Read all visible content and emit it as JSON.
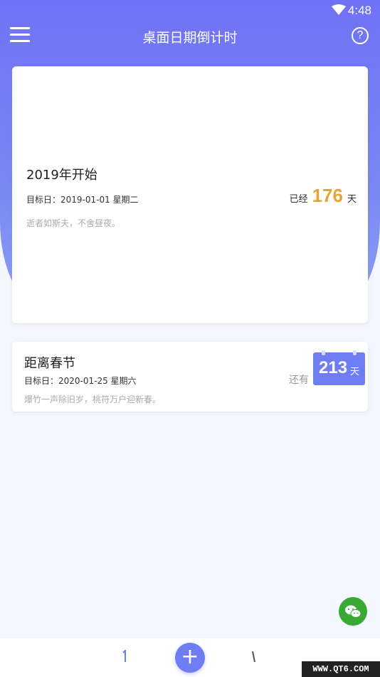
{
  "status": {
    "time": "4:48"
  },
  "header": {
    "title": "桌面日期倒计时",
    "help_label": "?"
  },
  "cards": [
    {
      "title": "2019年开始",
      "target_date": "目标日：2019-01-01 星期二",
      "quote": "逝者如斯夫，不舍昼夜。",
      "count_prefix": "已经",
      "count": "176",
      "count_unit": "天"
    },
    {
      "title": "距离春节",
      "target_date": "目标日：2020-01-25 星期六",
      "quote": "爆竹一声除旧岁，桃符万户迎新春。",
      "count_prefix": "还有",
      "count": "213",
      "count_unit": "天"
    }
  ],
  "bottom_bar": {
    "add_label": "+"
  },
  "watermark": "WWW.QT6.COM",
  "colors": {
    "accent": "#6f7df3",
    "highlight": "#e5a53a",
    "wechat": "#3aa835"
  },
  "icons": {
    "menu": "menu-icon",
    "help": "help-icon",
    "wifi": "wifi-icon",
    "wechat": "wechat-icon",
    "add": "add-icon"
  }
}
